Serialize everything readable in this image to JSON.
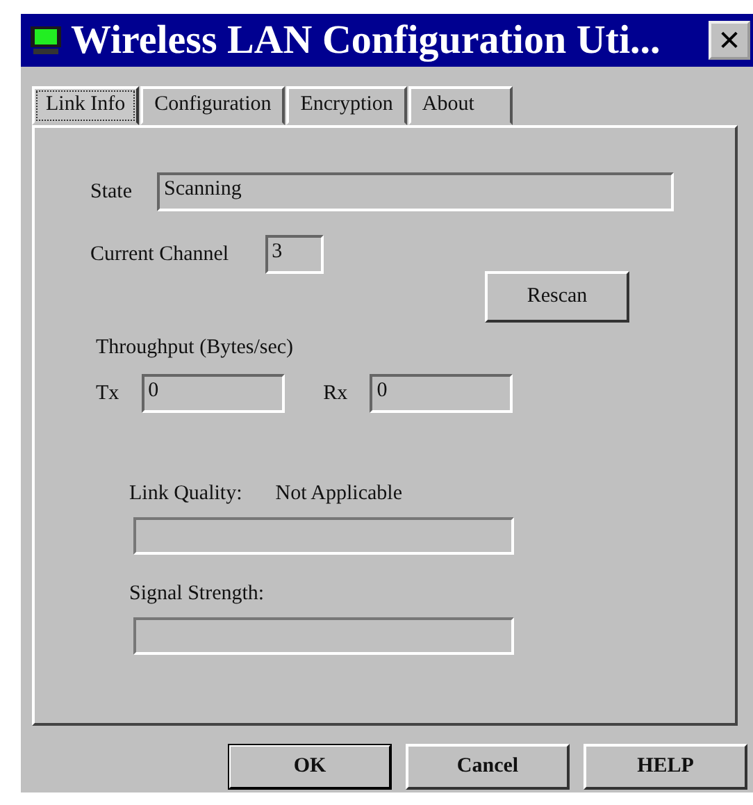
{
  "window": {
    "title": "Wireless LAN Configuration Uti...",
    "close": "✕"
  },
  "tabs": [
    {
      "label": "Link Info",
      "selected": true
    },
    {
      "label": "Configuration",
      "selected": false
    },
    {
      "label": "Encryption",
      "selected": false
    },
    {
      "label": "About",
      "selected": false
    }
  ],
  "state": {
    "label": "State",
    "value": "Scanning"
  },
  "channel": {
    "label": "Current Channel",
    "value": "3"
  },
  "rescan": "Rescan",
  "throughput": {
    "label": "Throughput (Bytes/sec)",
    "tx_label": "Tx",
    "tx_value": "0",
    "rx_label": "Rx",
    "rx_value": "0"
  },
  "link_quality": {
    "label": "Link Quality:",
    "reading": "Not Applicable",
    "level": 0
  },
  "signal_strength": {
    "label": "Signal Strength:",
    "level": 0
  },
  "buttons": [
    {
      "label": "OK",
      "default": true
    },
    {
      "label": "Cancel",
      "default": false
    },
    {
      "label": "HELP",
      "default": false
    }
  ]
}
